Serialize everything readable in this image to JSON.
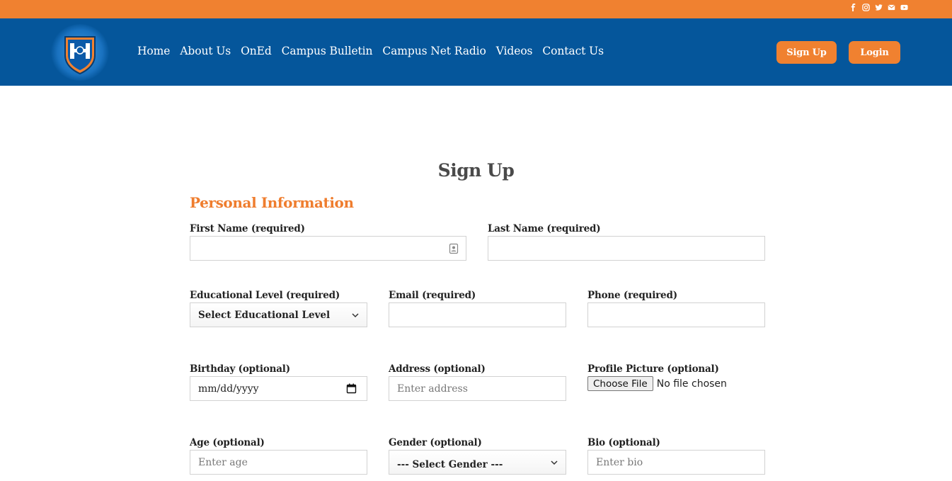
{
  "topbar": {
    "color": "#f08130",
    "social_icons": [
      "facebook-icon",
      "instagram-icon",
      "twitter-icon",
      "email-icon",
      "youtube-icon"
    ]
  },
  "header": {
    "color": "#05569b",
    "logo": "crest-logo",
    "nav": [
      "Home",
      "About Us",
      "OnEd",
      "Campus Bulletin",
      "Campus Net Radio",
      "Videos",
      "Contact Us"
    ],
    "signup_label": "Sign Up",
    "login_label": "Login"
  },
  "page_title": "Sign Up",
  "section_title": "Personal Information",
  "form": {
    "first_name": {
      "label": "First Name (required)",
      "value": ""
    },
    "last_name": {
      "label": "Last Name (required)",
      "value": ""
    },
    "edu_level": {
      "label": "Educational Level (required)",
      "selected": "Select Educational Level"
    },
    "email": {
      "label": "Email (required)",
      "value": ""
    },
    "phone": {
      "label": "Phone (required)",
      "value": ""
    },
    "birthday": {
      "label": "Birthday (optional)",
      "value": "mm/dd/yyyy"
    },
    "address": {
      "label": "Address (optional)",
      "placeholder": "Enter address"
    },
    "profile_picture": {
      "label": "Profile Picture (optional)",
      "button": "Choose File",
      "status": "No file chosen"
    },
    "age": {
      "label": "Age (optional)",
      "placeholder": "Enter age"
    },
    "gender": {
      "label": "Gender (optional)",
      "selected": "--- Select Gender ---"
    },
    "bio": {
      "label": "Bio (optional)",
      "placeholder": "Enter bio"
    }
  },
  "colors": {
    "accent": "#f08130",
    "brand_blue": "#05569b",
    "section_title": "#ef7d2e"
  }
}
